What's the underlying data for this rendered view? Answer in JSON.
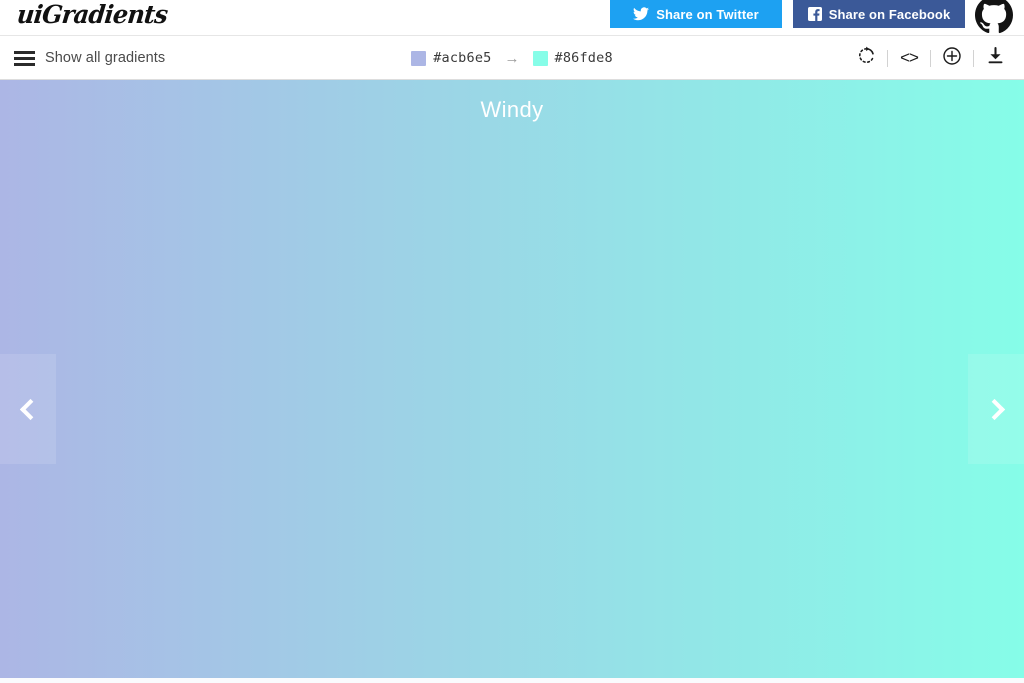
{
  "header": {
    "logo_text": "uiGradients",
    "share_twitter": {
      "label": "Share on Twitter",
      "icon": "twitter-icon",
      "color": "#1da1f2"
    },
    "share_facebook": {
      "label": "Share on Facebook",
      "icon": "facebook-icon",
      "color": "#3b5998"
    },
    "github": {
      "icon": "github-icon"
    }
  },
  "toolbar": {
    "show_all_label": "Show all gradients",
    "menu_icon": "hamburger-icon",
    "colors": {
      "start_hex": "#acb6e5",
      "end_hex": "#86fde8",
      "arrow": "→"
    },
    "tools": [
      {
        "name": "rotate-icon",
        "label": "Rotate gradient"
      },
      {
        "name": "code-icon",
        "label": "<>"
      },
      {
        "name": "plus-circle-icon",
        "label": "Add gradient"
      },
      {
        "name": "download-icon",
        "label": "Download"
      }
    ]
  },
  "stage": {
    "gradient_name": "Windy",
    "gradient_start": "#acb6e5",
    "gradient_end": "#86fde8",
    "gradient_direction": "to right",
    "prev_label": "‹",
    "next_label": "›"
  }
}
